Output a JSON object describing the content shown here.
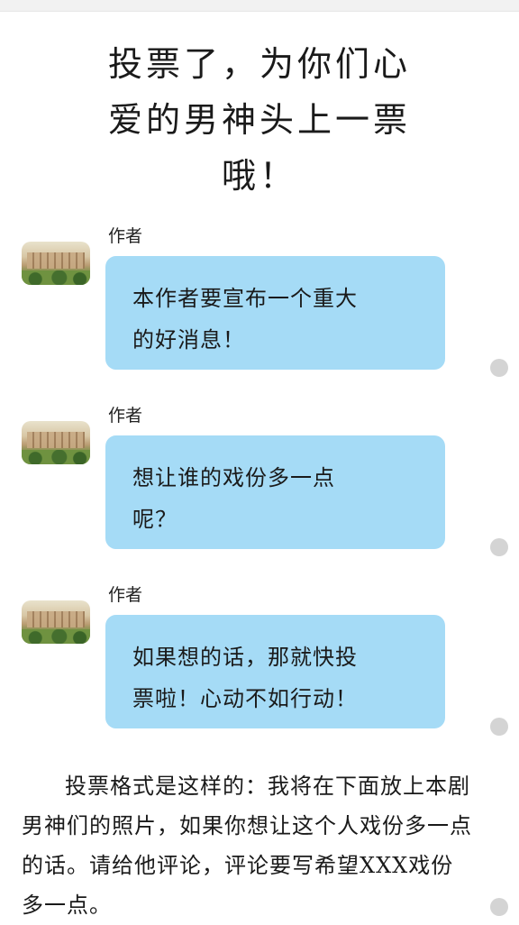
{
  "title_lines": [
    "投票了，为你们心",
    "爱的男神头上一票",
    "哦！"
  ],
  "messages": [
    {
      "author": "作者",
      "lines": [
        "本作者要宣布一个重大",
        "的好消息！"
      ]
    },
    {
      "author": "作者",
      "lines": [
        "想让谁的戏份多一点",
        "呢？"
      ]
    },
    {
      "author": "作者",
      "lines": [
        "如果想的话，那就快投",
        "票啦！心动不如行动！"
      ]
    }
  ],
  "body_text": "投票格式是这样的：我将在下面放上本剧男神们的照片，如果你想让这个人戏份多一点的话。请给他评论，评论要写希望XXX戏份多一点。"
}
